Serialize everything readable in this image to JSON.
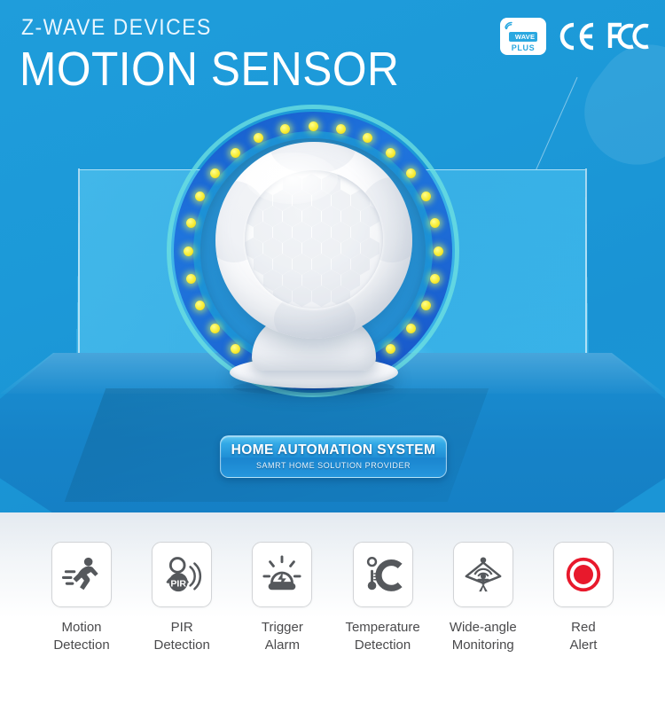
{
  "header": {
    "eyebrow": "Z-WAVE DEVICES",
    "headline": "MOTION SENSOR"
  },
  "certifications": [
    {
      "name": "zwave-plus-badge",
      "word": "WAVE",
      "mark": "Z",
      "plus": "PLUS"
    },
    {
      "name": "ce-mark",
      "label": "CE"
    },
    {
      "name": "fcc-mark",
      "label": "FC"
    }
  ],
  "product": {
    "name": "motion-sensor",
    "led_count": 28
  },
  "callout": {
    "title": "HOME AUTOMATION SYSTEM",
    "subtitle": "SAMRT HOME SOLUTION PROVIDER"
  },
  "features": [
    {
      "icon": "running-person-icon",
      "label": "Motion\nDetection"
    },
    {
      "icon": "pir-person-waves-icon",
      "label": "PIR\nDetection"
    },
    {
      "icon": "alarm-siren-icon",
      "label": "Trigger\nAlarm"
    },
    {
      "icon": "thermometer-celsius-icon",
      "label": "Temperature\nDetection"
    },
    {
      "icon": "wide-angle-person-icon",
      "label": "Wide-angle\nMonitoring"
    },
    {
      "icon": "red-alert-circle-icon",
      "label": "Red\nAlert"
    }
  ],
  "colors": {
    "background_blue": "#1d9cd8",
    "panel_blue": "#31b2ec",
    "stage_blue": "#1683c8",
    "led_yellow": "#f7ec33",
    "ring_blue": "#1f74dd",
    "alert_red": "#e8192c",
    "icon_gray": "#55585c",
    "label_gray": "#4a4a4c"
  }
}
